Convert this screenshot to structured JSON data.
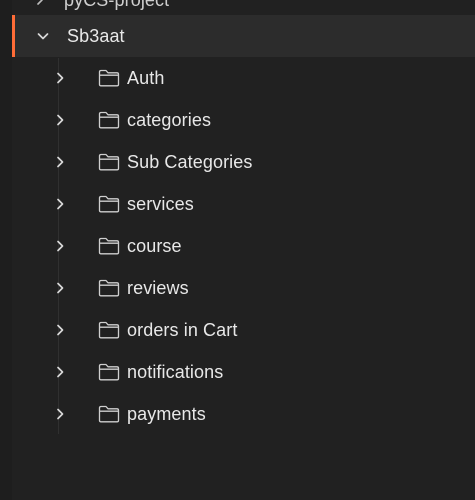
{
  "tree": {
    "partial_item": {
      "label": "pyCS-project"
    },
    "collection": {
      "label": "Sb3aat",
      "expanded": true
    },
    "folders": [
      {
        "label": "Auth"
      },
      {
        "label": "categories"
      },
      {
        "label": "Sub Categories"
      },
      {
        "label": "services"
      },
      {
        "label": "course"
      },
      {
        "label": "reviews"
      },
      {
        "label": "orders in Cart"
      },
      {
        "label": "notifications"
      },
      {
        "label": "payments"
      }
    ]
  },
  "colors": {
    "accent": "#ff6c37",
    "background": "#212121",
    "selected_row": "#2c2c2c",
    "text": "#e8e8e8"
  },
  "icons": {
    "collapsed": "chevron-right-icon",
    "expanded": "chevron-down-icon",
    "folder": "folder-icon"
  }
}
